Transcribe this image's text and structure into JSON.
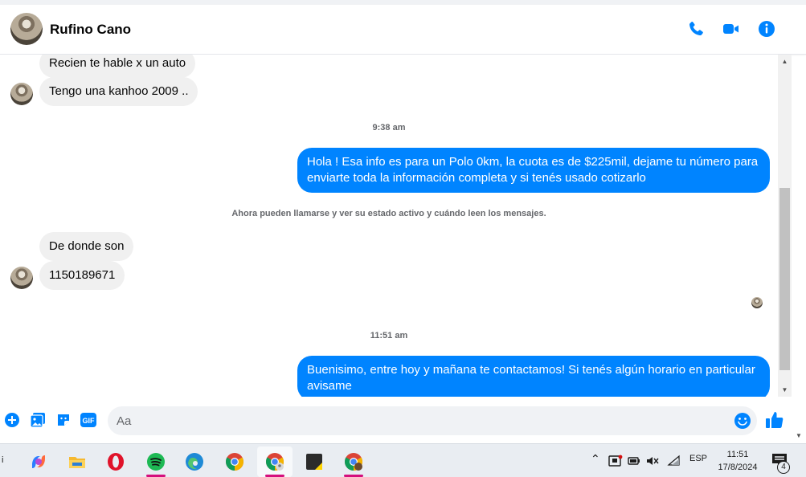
{
  "header": {
    "contact_name": "Rufino Cano",
    "icons": [
      "phone-icon",
      "video-call-icon",
      "info-icon"
    ],
    "accent_color": "#0084ff"
  },
  "messages": {
    "incoming_1": "Recien te hable x un auto",
    "incoming_2": "Tengo una kanhoo 2009 ..",
    "time_1": "9:38 am",
    "outgoing_1": "Hola ! Esa info es para un Polo 0km, la cuota es de $225mil, dejame tu número para enviarte toda la información completa y si tenés usado cotizarlo",
    "system_note": "Ahora pueden llamarse y ver su estado activo y cuándo leen los mensajes.",
    "incoming_3": "De donde son",
    "incoming_4": "1150189671",
    "time_2": "11:51 am",
    "outgoing_2": "Buenisimo, entre hoy y mañana te contactamos! Si tenés algún horario en particular avisame"
  },
  "composer": {
    "placeholder": "Aa",
    "icons": [
      "add-icon",
      "photo-icon",
      "sticker-icon",
      "gif-icon",
      "emoji-icon",
      "like-icon"
    ],
    "gif_label": "GIF"
  },
  "taskbar": {
    "apps": [
      "copilot-icon",
      "file-explorer-icon",
      "opera-icon",
      "spotify-icon",
      "edge-icon",
      "chrome-icon",
      "chrome-profile-icon",
      "sticky-notes-icon",
      "chrome-profile-2-icon"
    ],
    "language": "ESP",
    "time": "11:51",
    "date": "17/8/2024",
    "notification_count": "4",
    "left_marker": "i"
  }
}
